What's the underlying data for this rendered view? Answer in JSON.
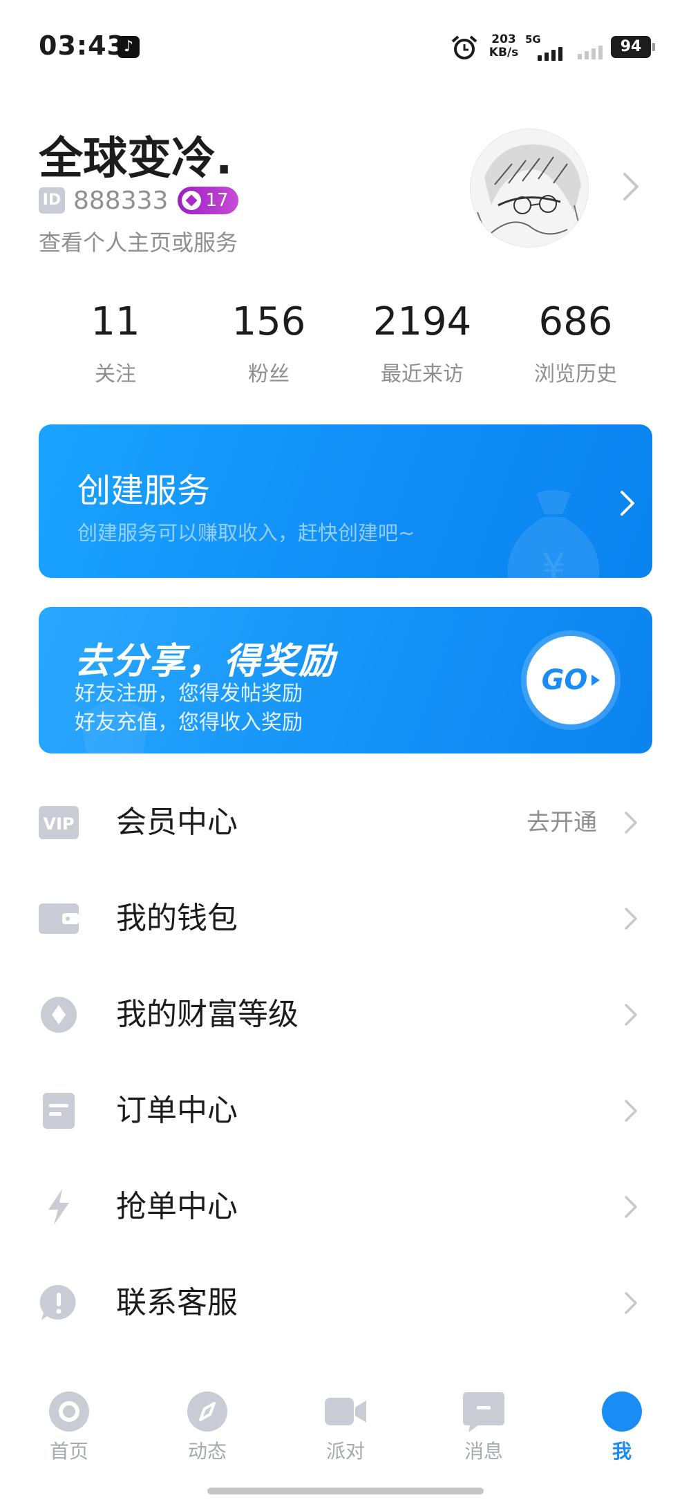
{
  "status_bar": {
    "time": "03:43",
    "net_speed_value": "203",
    "net_speed_unit": "KB/s",
    "network_type": "5G",
    "battery_level": "94"
  },
  "profile": {
    "name": "全球变冷.",
    "id_tag": "ID",
    "id_value": "888333",
    "level": "17",
    "subtitle": "查看个人主页或服务"
  },
  "stats": [
    {
      "value": "11",
      "label": "关注"
    },
    {
      "value": "156",
      "label": "粉丝"
    },
    {
      "value": "2194",
      "label": "最近来访"
    },
    {
      "value": "686",
      "label": "浏览历史"
    }
  ],
  "create_card": {
    "title": "创建服务",
    "description": "创建服务可以赚取收入，赶快创建吧~"
  },
  "share_card": {
    "title": "去分享，得奖励",
    "line1": "好友注册，您得发帖奖励",
    "line2": "好友充值，您得收入奖励",
    "go_label": "GO"
  },
  "menu": {
    "items": [
      {
        "label": "会员中心",
        "hint": "去开通",
        "icon": "vip-icon"
      },
      {
        "label": "我的钱包",
        "hint": "",
        "icon": "wallet-icon"
      },
      {
        "label": "我的财富等级",
        "hint": "",
        "icon": "diamond-icon"
      },
      {
        "label": "订单中心",
        "hint": "",
        "icon": "document-icon"
      },
      {
        "label": "抢单中心",
        "hint": "",
        "icon": "lightning-icon"
      },
      {
        "label": "联系客服",
        "hint": "",
        "icon": "exclamation-icon"
      }
    ]
  },
  "tabbar": {
    "tabs": [
      {
        "label": "首页",
        "icon": "home-icon"
      },
      {
        "label": "动态",
        "icon": "compass-icon"
      },
      {
        "label": "派对",
        "icon": "video-camera-icon"
      },
      {
        "label": "消息",
        "icon": "message-icon"
      },
      {
        "label": "我",
        "icon": "profile-icon",
        "active": true
      }
    ]
  },
  "colors": {
    "accent": "#1a8cf5",
    "text_primary": "#1c1c1e",
    "text_secondary": "#8e8e93",
    "icon_grey": "#c9ccd4",
    "level_badge": "#a82ac9"
  }
}
